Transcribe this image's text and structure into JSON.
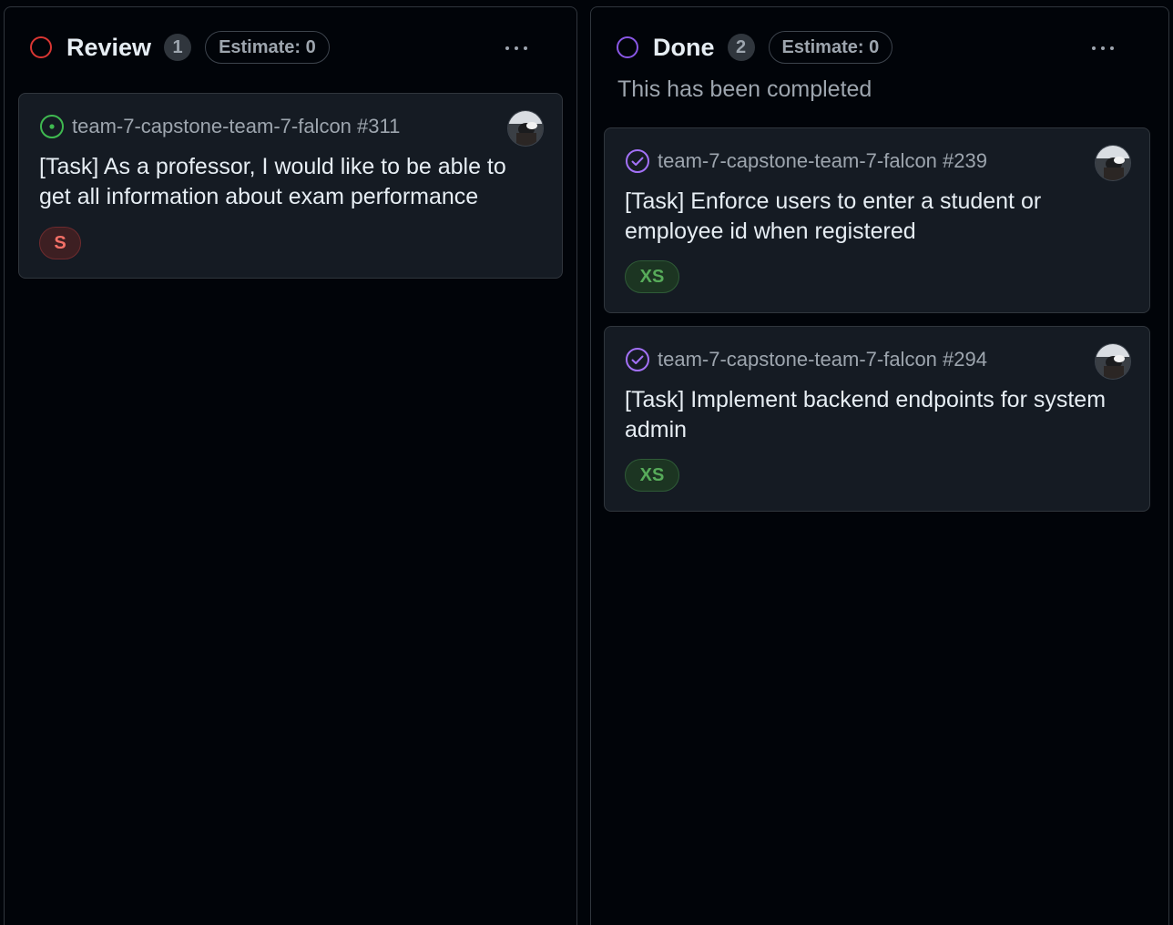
{
  "colors": {
    "background": "#010409",
    "card": "#151b23",
    "border": "#30363d",
    "review_status": "#da3633",
    "done_status": "#8957e5",
    "open_issue": "#3fb950",
    "closed_issue": "#a371f7",
    "label_s": "#f47067",
    "label_xs": "#57ab5a"
  },
  "columns": [
    {
      "title": "Review",
      "count": "1",
      "estimate": "Estimate: 0",
      "description": "",
      "cards": [
        {
          "state": "open",
          "icon": "issue-opened-icon",
          "ref": "team-7-capstone-team-7-falcon #311",
          "title": "[Task] As a professor, I would like to be able to get all information about exam performance",
          "label": "S"
        }
      ]
    },
    {
      "title": "Done",
      "count": "2",
      "estimate": "Estimate: 0",
      "description": "This has been completed",
      "cards": [
        {
          "state": "closed",
          "icon": "issue-closed-icon",
          "ref": "team-7-capstone-team-7-falcon #239",
          "title": "[Task] Enforce users to enter a student or employee id when registered",
          "label": "XS"
        },
        {
          "state": "closed",
          "icon": "issue-closed-icon",
          "ref": "team-7-capstone-team-7-falcon #294",
          "title": "[Task] Implement backend endpoints for system admin",
          "label": "XS"
        }
      ]
    }
  ]
}
